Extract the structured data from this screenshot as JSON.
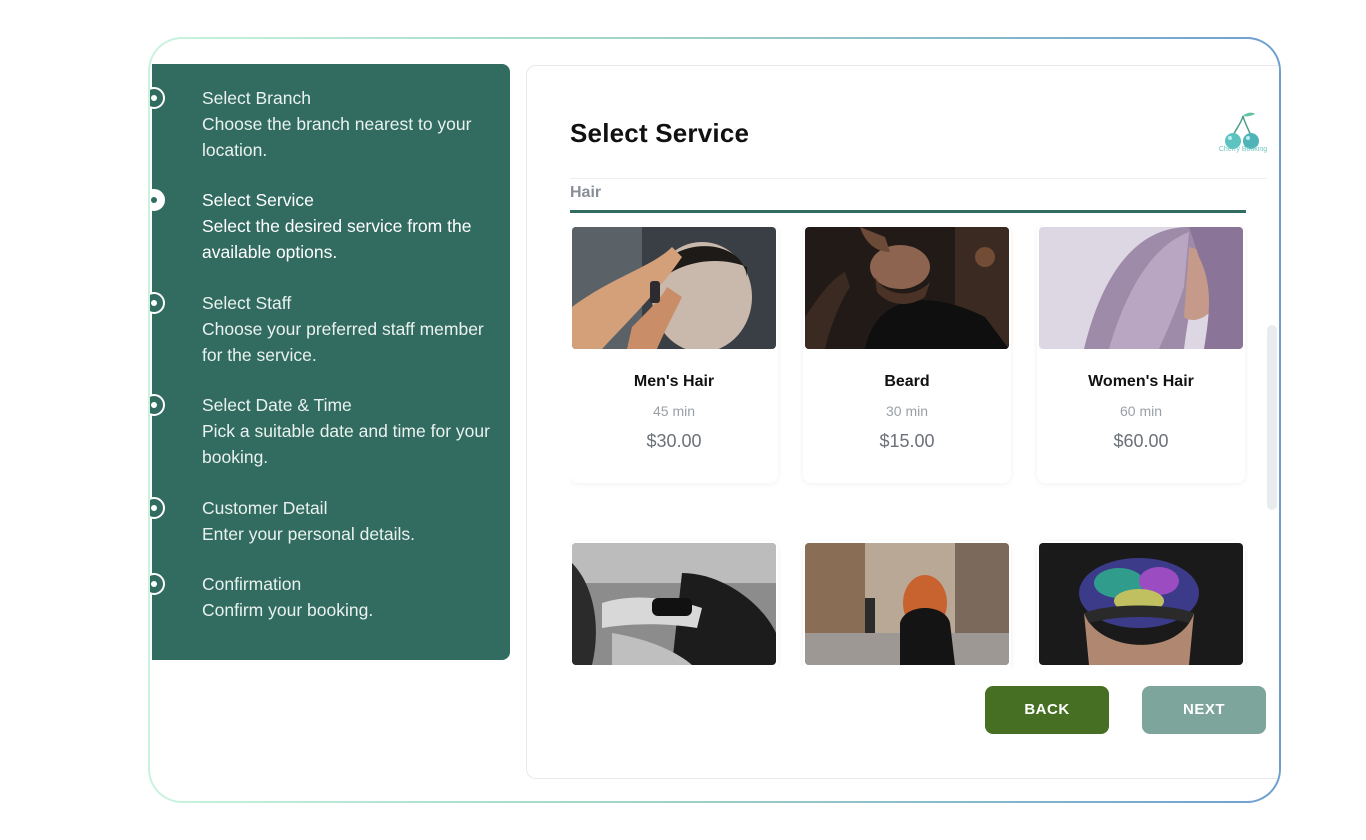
{
  "steps": [
    {
      "title": "Select Branch",
      "desc": "Choose the branch nearest to your location.",
      "active": false
    },
    {
      "title": "Select Service",
      "desc": "Select the desired service from the available options.",
      "active": true
    },
    {
      "title": "Select Staff",
      "desc": "Choose your preferred staff member for the service.",
      "active": false
    },
    {
      "title": "Select Date & Time",
      "desc": "Pick a suitable date and time for your booking.",
      "active": false
    },
    {
      "title": "Customer Detail",
      "desc": "Enter your personal details.",
      "active": false
    },
    {
      "title": "Confirmation",
      "desc": "Confirm your booking.",
      "active": false
    }
  ],
  "main": {
    "title": "Select Service",
    "logo_text": "Cherry Booking",
    "category": "Hair"
  },
  "services": [
    {
      "name": "Men's Hair",
      "duration": "45 min",
      "price": "$30.00",
      "image": "barber-clipper"
    },
    {
      "name": "Beard",
      "duration": "30 min",
      "price": "$15.00",
      "image": "beard-shave"
    },
    {
      "name": "Women's Hair",
      "duration": "60 min",
      "price": "$60.00",
      "image": "lavender-hair"
    },
    {
      "name": "",
      "duration": "",
      "price": "",
      "image": "blow-dry"
    },
    {
      "name": "",
      "duration": "",
      "price": "",
      "image": "redhead-street"
    },
    {
      "name": "",
      "duration": "",
      "price": "",
      "image": "rainbow-hair"
    }
  ],
  "buttons": {
    "back": "BACK",
    "next": "NEXT"
  },
  "colors": {
    "panel": "#326b60",
    "back_button": "#466f24",
    "next_button": "#7da59b",
    "accent": "#326b60"
  }
}
